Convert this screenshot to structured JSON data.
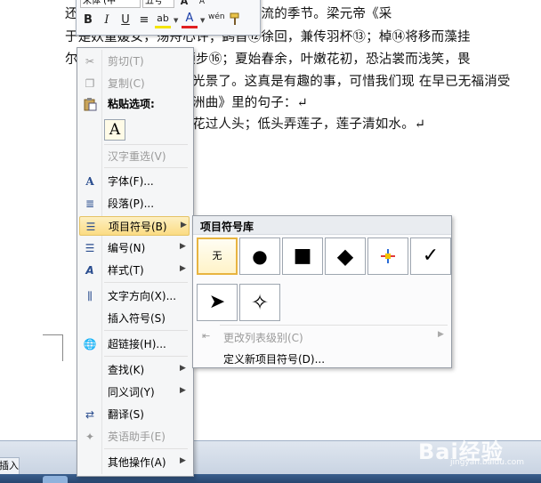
{
  "document": {
    "lines": [
      "还可以在热闹的季节，也是一个风流的季节。梁元帝《采",
      "于是妖童媛女，荡舟心许；鹢首⑫徐回，兼传羽杯⑬；棹⑭将移而藻挂",
      "尔其纤腰束素，迁延顾步⑯；夏始春余，叶嫩花初，恐沾裳而浅笑，畏",
      "光景了。这真是有趣的事，可惜我们现 在早已无福消受",
      "洲曲》里的句子：↵",
      "花过人头；低头弄莲子，莲子清如水。↵"
    ]
  },
  "mini_toolbar": {
    "font_name": "宋体 (中",
    "font_size": "五号",
    "bold": "B",
    "italic": "I",
    "underline": "U",
    "center": "≡",
    "highlight": "ab",
    "font_color": "A",
    "phonetic": "wén",
    "format_painter": "format-painter-icon"
  },
  "context_menu": {
    "cut": "剪切(T)",
    "copy": "复制(C)",
    "paste_options": "粘贴选项:",
    "paste_keep_text": "A",
    "reconvert": "汉字重选(V)",
    "font": "字体(F)...",
    "paragraph": "段落(P)...",
    "bullets": "项目符号(B)",
    "numbering": "编号(N)",
    "styles": "样式(T)",
    "text_direction": "文字方向(X)...",
    "insert_symbol": "插入符号(S)",
    "hyperlink": "超链接(H)...",
    "lookup": "查找(K)",
    "synonyms": "同义词(Y)",
    "translate": "翻译(S)",
    "english_assistant": "英语助手(E)",
    "other_actions": "其他操作(A)"
  },
  "bullet_submenu": {
    "title": "项目符号库",
    "none_label": "无",
    "symbols": [
      "●",
      "■",
      "◆",
      "✓",
      "➤",
      "✧"
    ],
    "change_level": "更改列表级别(C)",
    "define_new": "定义新项目符号(D)..."
  },
  "status": {
    "insert": "插入"
  },
  "watermark": {
    "brand": "Bai经验",
    "url": "jingyan.baidu.com"
  },
  "colors": {
    "highlight": "#f4e400",
    "font_color": "#e02020",
    "menu_hover": "#fbdc83"
  }
}
